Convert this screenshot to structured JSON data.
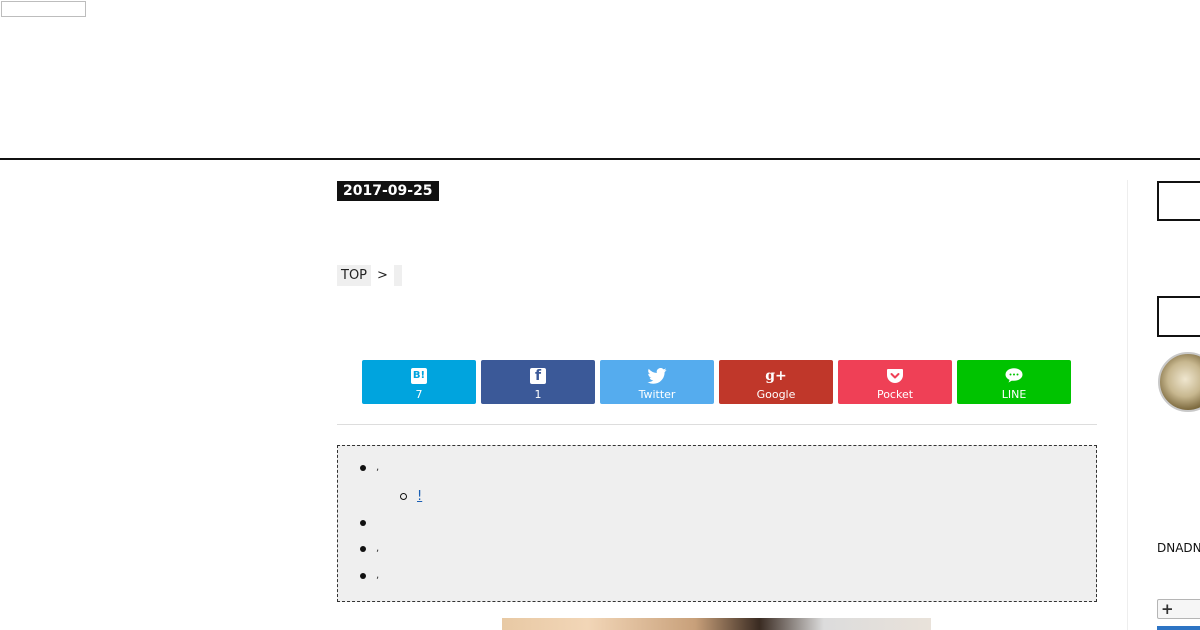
{
  "header": {
    "date": "2017-09-25"
  },
  "breadcrumb": {
    "top_label": "TOP",
    "separator": ">"
  },
  "share_buttons": [
    {
      "service": "hatena",
      "icon_text": "B!",
      "label": "7",
      "color": "#00a4de"
    },
    {
      "service": "facebook",
      "icon_text": "f",
      "label": "1",
      "color": "#3b5998"
    },
    {
      "service": "twitter",
      "label": "Twitter",
      "color": "#55acee"
    },
    {
      "service": "google",
      "icon_text": "g+",
      "label": "Google",
      "color": "#c0372a"
    },
    {
      "service": "pocket",
      "label": "Pocket",
      "color": "#ef4056"
    },
    {
      "service": "line",
      "label": "LINE",
      "color": "#00c300"
    }
  ],
  "toc": {
    "items": [
      {
        "text": ",",
        "level": 1,
        "link": false
      },
      {
        "text": "!",
        "level": 2,
        "link": true
      },
      {
        "text": "",
        "level": 1,
        "link": true
      },
      {
        "text": ",",
        "level": 1,
        "link": false
      },
      {
        "text": ",",
        "level": 1,
        "link": false
      }
    ]
  },
  "sidebar": {
    "text": "DNADN",
    "plus_label": "+"
  }
}
